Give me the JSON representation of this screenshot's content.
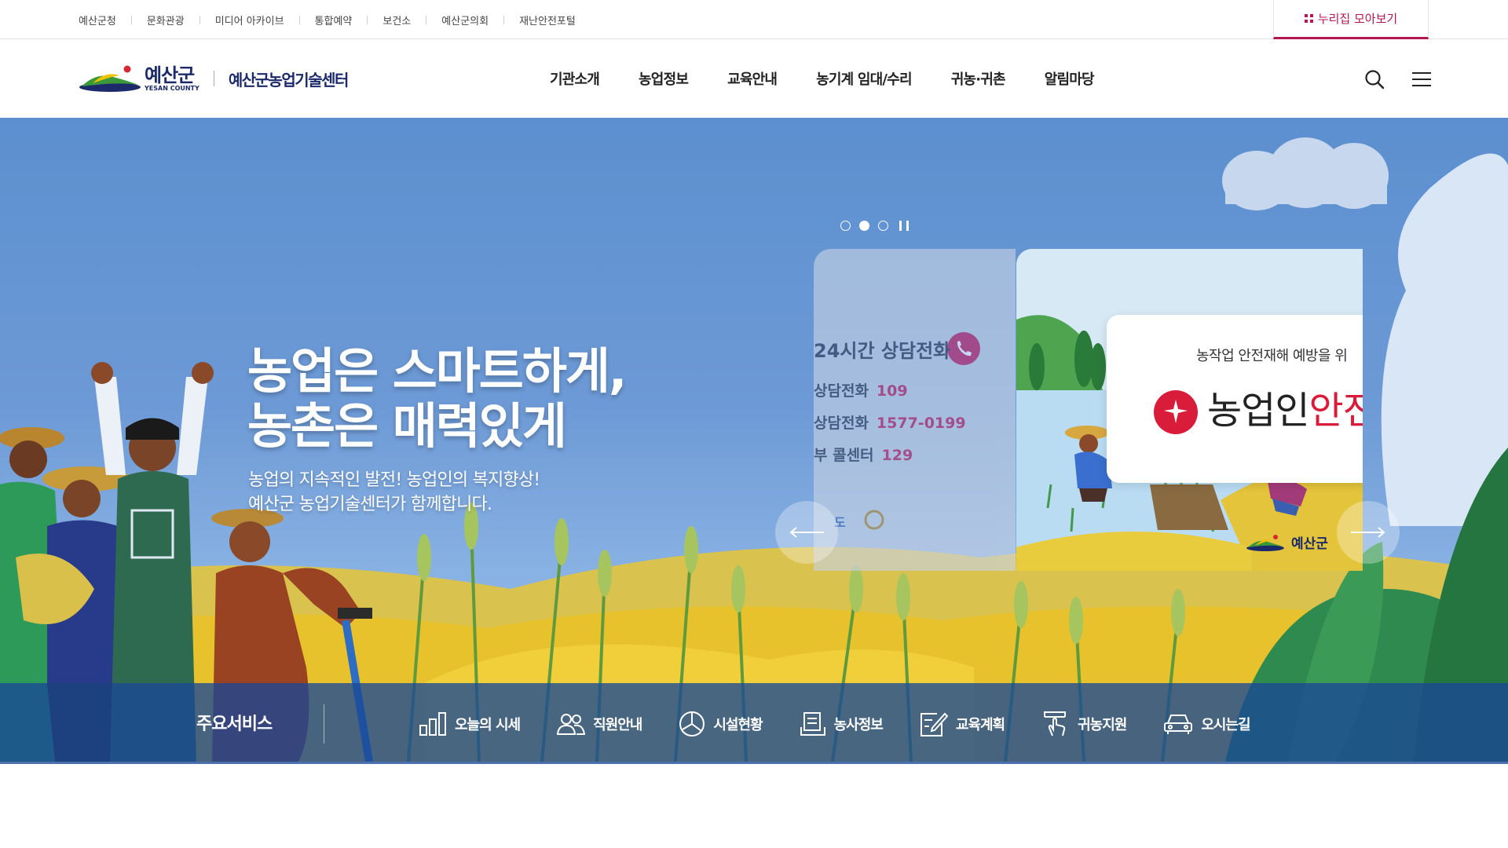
{
  "utility_links": [
    "예산군청",
    "문화관광",
    "미디어 아카이브",
    "통합예약",
    "보건소",
    "예산군의회",
    "재난안전포털"
  ],
  "mobile_btn": "누리집 모아보기",
  "logo": {
    "korean": "예산군",
    "english": "YESAN COUNTY",
    "center_name": "예산군농업기술센터"
  },
  "nav": [
    "기관소개",
    "농업정보",
    "교육안내",
    "농기계 임대/수리",
    "귀농·귀촌",
    "알림마당"
  ],
  "hero": {
    "title_line1": "농업은 스마트하게,",
    "title_line2": "농촌은 매력있게",
    "sub_line1": "농업의 지속적인 발전! 농업인의 복지향상!",
    "sub_line2": "예산군 농업기술센터가 함께합니다."
  },
  "slider": {
    "dots": 3,
    "active_index": 1
  },
  "card_prev": {
    "title": "24시간 상담전화",
    "rows": [
      {
        "label": "상담전화",
        "num": "109"
      },
      {
        "label": "상담전화",
        "num": "1577-0199"
      },
      {
        "label": "부 콜센터",
        "num": "129"
      }
    ],
    "footer": "도"
  },
  "card_main": {
    "line1": "농작업 안전재해 예방을 위",
    "line2_plain": "농업인",
    "line2_accent": "안전",
    "logo_text": "예산군"
  },
  "services": {
    "title": "주요서비스",
    "items": [
      {
        "label": "오늘의 시세",
        "icon": "chart-bar-icon"
      },
      {
        "label": "직원안내",
        "icon": "people-icon"
      },
      {
        "label": "시설현황",
        "icon": "pie-chart-icon"
      },
      {
        "label": "농사정보",
        "icon": "document-computer-icon"
      },
      {
        "label": "교육계획",
        "icon": "pencil-note-icon"
      },
      {
        "label": "귀농지원",
        "icon": "hand-pointer-icon"
      },
      {
        "label": "오시는길",
        "icon": "car-icon"
      }
    ]
  },
  "colors": {
    "brand_navy": "#1c2a6b",
    "accent_red": "#b4174f",
    "service_bar": "#1a4896",
    "sky": "#6d9ad6"
  }
}
